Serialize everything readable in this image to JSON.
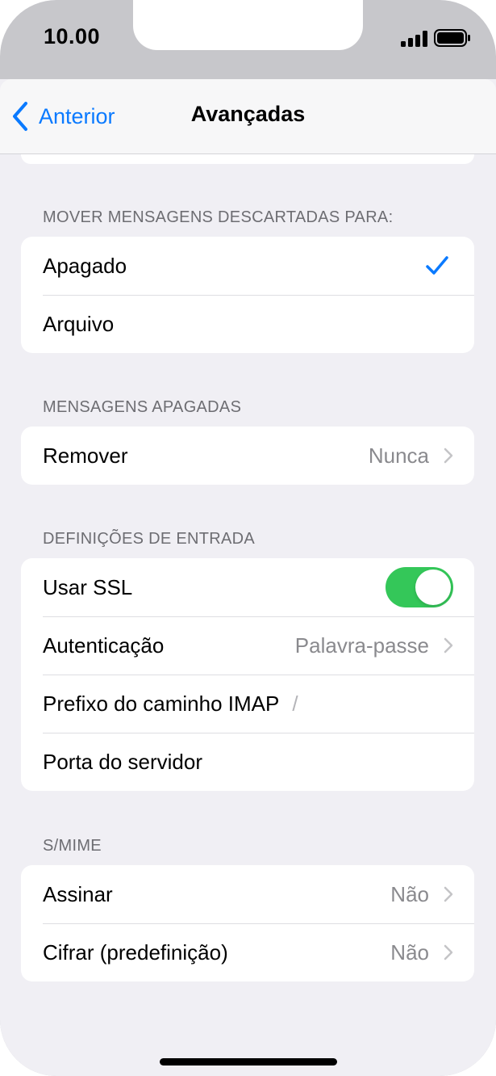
{
  "status_bar": {
    "time": "10.00"
  },
  "nav": {
    "back_label": "Anterior",
    "title": "Avançadas"
  },
  "sections": {
    "discard": {
      "header": "MOVER MENSAGENS DESCARTADAS PARA:",
      "items": [
        {
          "label": "Apagado",
          "selected": true
        },
        {
          "label": "Arquivo",
          "selected": false
        }
      ]
    },
    "deleted": {
      "header": "MENSAGENS APAGADAS",
      "remove_label": "Remover",
      "remove_value": "Nunca"
    },
    "incoming": {
      "header": "DEFINIÇÕES DE ENTRADA",
      "ssl_label": "Usar SSL",
      "ssl_on": true,
      "auth_label": "Autenticação",
      "auth_value": "Palavra-passe",
      "imap_prefix_label": "Prefixo do caminho IMAP",
      "imap_prefix_value": "/",
      "server_port_label": "Porta do servidor"
    },
    "smime": {
      "header": "S/MIME",
      "sign_label": "Assinar",
      "sign_value": "Não",
      "encrypt_label": "Cifrar (predefinição)",
      "encrypt_value": "Não"
    }
  },
  "colors": {
    "accent": "#0a7aff",
    "toggle_on": "#34c759",
    "background": "#f0eff4"
  }
}
